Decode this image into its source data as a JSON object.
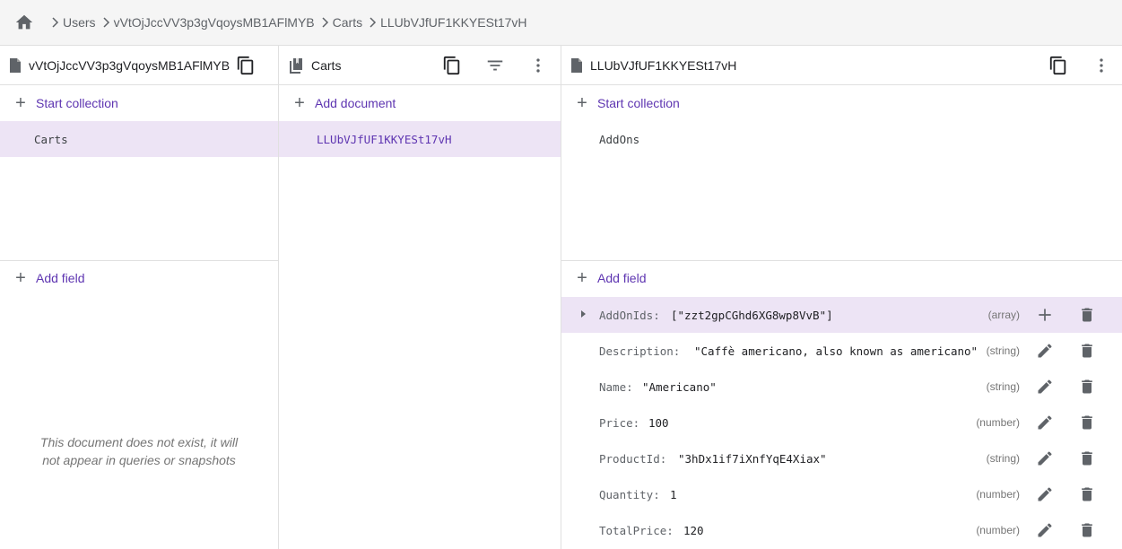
{
  "breadcrumb": {
    "home_icon": "home-icon",
    "items": [
      "Users",
      "vVtOjJccVV3p3gVqoysMB1AFlMYB",
      "Carts",
      "LLUbVJfUF1KKYESt17vH"
    ]
  },
  "panels": {
    "user_doc": {
      "icon": "document-icon",
      "title": "vVtOjJccVV3p3gVqoysMB1AFlMYB",
      "start_collection": "Start collection",
      "collections": [
        "Carts"
      ],
      "add_field": "Add field",
      "empty_message_line1": "This document does not exist, it will",
      "empty_message_line2": "not appear in queries or snapshots"
    },
    "carts_collection": {
      "icon": "collection-icon",
      "title": "Carts",
      "add_document": "Add document",
      "documents": [
        "LLUbVJfUF1KKYESt17vH"
      ]
    },
    "cart_doc": {
      "icon": "document-icon",
      "title": "LLUbVJfUF1KKYESt17vH",
      "start_collection": "Start collection",
      "collections": [
        "AddOns"
      ],
      "add_field": "Add field",
      "fields": [
        {
          "key": "AddOnIds:",
          "value": "[\"zzt2gpCGhd6XG8wp8VvB\"]",
          "type": "(array)"
        },
        {
          "key": "Description:",
          "value": "\"Caffè americano, also known as americano\"",
          "type": "(string)"
        },
        {
          "key": "Name:",
          "value": "\"Americano\"",
          "type": "(string)"
        },
        {
          "key": "Price:",
          "value": "100",
          "type": "(number)"
        },
        {
          "key": "ProductId:",
          "value": "\"3hDx1if7iXnfYqE4Xiax\"",
          "type": "(string)"
        },
        {
          "key": "Quantity:",
          "value": "1",
          "type": "(number)"
        },
        {
          "key": "TotalPrice:",
          "value": "120",
          "type": "(number)"
        }
      ]
    }
  },
  "colors": {
    "accent": "#5e35b1",
    "selected_bg": "#ede4f5"
  }
}
